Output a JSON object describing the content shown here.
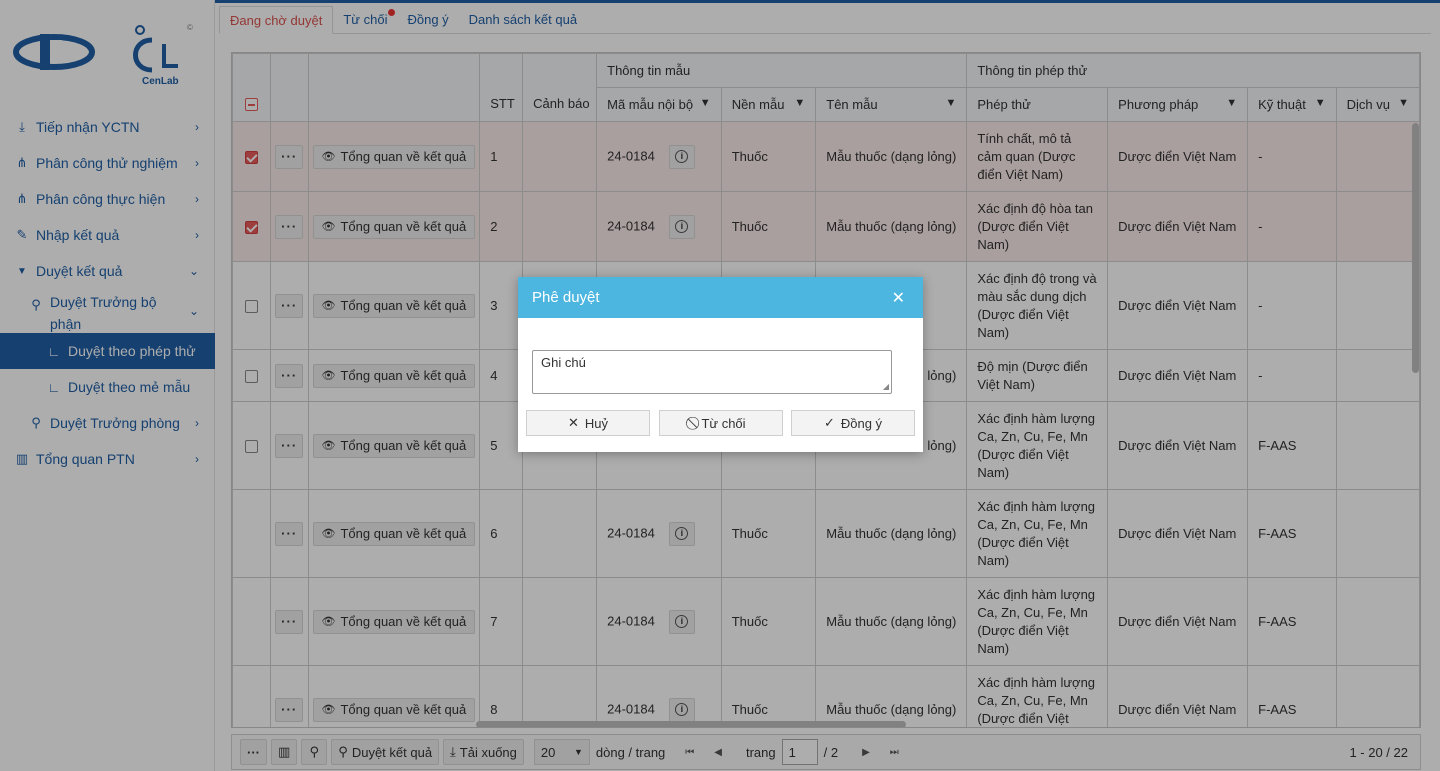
{
  "logo": {
    "brand": "CenLab",
    "copyright": "©"
  },
  "sidebar": {
    "items": [
      {
        "label": "Tiếp nhận YCTN",
        "icon": "download-icon",
        "glyph": "⤓",
        "chevron": "›"
      },
      {
        "label": "Phân công thử nghiệm",
        "icon": "sitemap-icon",
        "glyph": "⋔",
        "chevron": "›"
      },
      {
        "label": "Phân công thực hiện",
        "icon": "sitemap-icon",
        "glyph": "⋔",
        "chevron": "›"
      },
      {
        "label": "Nhập kết quả",
        "icon": "pencil-icon",
        "glyph": "✎",
        "chevron": "›"
      },
      {
        "label": "Duyệt kết quả",
        "icon": "filter-icon",
        "glyph": "▼",
        "chevron": "⌄"
      },
      {
        "label": "Duyệt Trưởng bộ phận",
        "icon": "microscope-icon",
        "glyph": "⚲",
        "chevron": "⌄"
      },
      {
        "label": "Duyệt theo phép thử",
        "icon": "branch-icon",
        "glyph": "∟"
      },
      {
        "label": "Duyệt theo mẻ mẫu",
        "icon": "branch-icon",
        "glyph": "∟"
      },
      {
        "label": "Duyệt Trưởng phòng",
        "icon": "microscope-icon",
        "glyph": "⚲",
        "chevron": "›"
      },
      {
        "label": "Tổng quan PTN",
        "icon": "chart-icon",
        "glyph": "▥",
        "chevron": "›"
      }
    ]
  },
  "tabs": [
    {
      "label": "Đang chờ duyệt"
    },
    {
      "label": "Từ chối"
    },
    {
      "label": "Đồng ý"
    },
    {
      "label": "Danh sách kết quả"
    }
  ],
  "table": {
    "group_headers": {
      "sample_info": "Thông tin mẫu",
      "test_info": "Thông tin phép thử"
    },
    "columns": {
      "stt": "STT",
      "warning": "Cảnh báo",
      "internal_code": "Mã mẫu nội bộ",
      "matrix": "Nền mẫu",
      "sample_name": "Tên mẫu",
      "test": "Phép thử",
      "method": "Phương pháp",
      "technique": "Kỹ thuật",
      "service": "Dịch vụ"
    },
    "overview_label": "Tổng quan về kết quả",
    "more_label": "···",
    "info_label": "i",
    "rows": [
      {
        "stt": "1",
        "code": "24-0184",
        "matrix": "Thuốc",
        "name": "Mẫu thuốc (dạng lỏng)",
        "test": "Tính chất, mô tả cảm quan (Dược điển Việt Nam)",
        "method": "Dược điển Việt Nam",
        "technique": "-",
        "checked": true,
        "checkbox": true
      },
      {
        "stt": "2",
        "code": "24-0184",
        "matrix": "Thuốc",
        "name": "Mẫu thuốc (dạng lỏng)",
        "test": "Xác định độ hòa tan (Dược điển Việt Nam)",
        "method": "Dược điển Việt Nam",
        "technique": "-",
        "checked": true,
        "checkbox": true
      },
      {
        "stt": "3",
        "code": "",
        "matrix": "",
        "name": "",
        "test": "Xác định độ trong và màu sắc dung dịch (Dược điển Việt Nam)",
        "method": "Dược điển Việt Nam",
        "technique": "-",
        "checked": false,
        "checkbox": true
      },
      {
        "stt": "4",
        "code": "",
        "matrix": "",
        "name": "lỏng)",
        "test": "Độ mịn (Dược điển Việt Nam)",
        "method": "Dược điển Việt Nam",
        "technique": "-",
        "checked": false,
        "checkbox": true
      },
      {
        "stt": "5",
        "code": "",
        "matrix": "",
        "name": "lỏng)",
        "test": "Xác định hàm lượng Ca, Zn, Cu, Fe, Mn (Dược điển Việt Nam)",
        "method": "Dược điển Việt Nam",
        "technique": "F-AAS",
        "checked": false,
        "checkbox": true
      },
      {
        "stt": "6",
        "code": "24-0184",
        "matrix": "Thuốc",
        "name": "Mẫu thuốc (dạng lỏng)",
        "test": "Xác định hàm lượng Ca, Zn, Cu, Fe, Mn (Dược điển Việt Nam)",
        "method": "Dược điển Việt Nam",
        "technique": "F-AAS",
        "checked": false,
        "checkbox": false
      },
      {
        "stt": "7",
        "code": "24-0184",
        "matrix": "Thuốc",
        "name": "Mẫu thuốc (dạng lỏng)",
        "test": "Xác định hàm lượng Ca, Zn, Cu, Fe, Mn (Dược điển Việt Nam)",
        "method": "Dược điển Việt Nam",
        "technique": "F-AAS",
        "checked": false,
        "checkbox": false
      },
      {
        "stt": "8",
        "code": "24-0184",
        "matrix": "Thuốc",
        "name": "Mẫu thuốc (dạng lỏng)",
        "test": "Xác định hàm lượng Ca, Zn, Cu, Fe, Mn (Dược điển Việt Nam)",
        "method": "Dược điển Việt Nam",
        "technique": "F-AAS",
        "checked": false,
        "checkbox": false
      }
    ]
  },
  "footer": {
    "approve_label": "Duyệt kết quả",
    "download_label": "Tải xuống",
    "page_size": "20",
    "per_page_label": "dòng / trang",
    "page_label": "trang",
    "page_value": "1",
    "page_total": "/ 2",
    "range_text": "1 - 20 / 22"
  },
  "dialog": {
    "title": "Phê duyệt",
    "note_placeholder": "Ghi chú",
    "cancel_label": "Huỷ",
    "reject_label": "Từ chối",
    "approve_label": "Đồng ý"
  },
  "colors": {
    "primary": "#1f5fa6",
    "dialog_header": "#4cb6e0",
    "selected_row": "#fbeaea",
    "active_tab": "#d9534f"
  }
}
